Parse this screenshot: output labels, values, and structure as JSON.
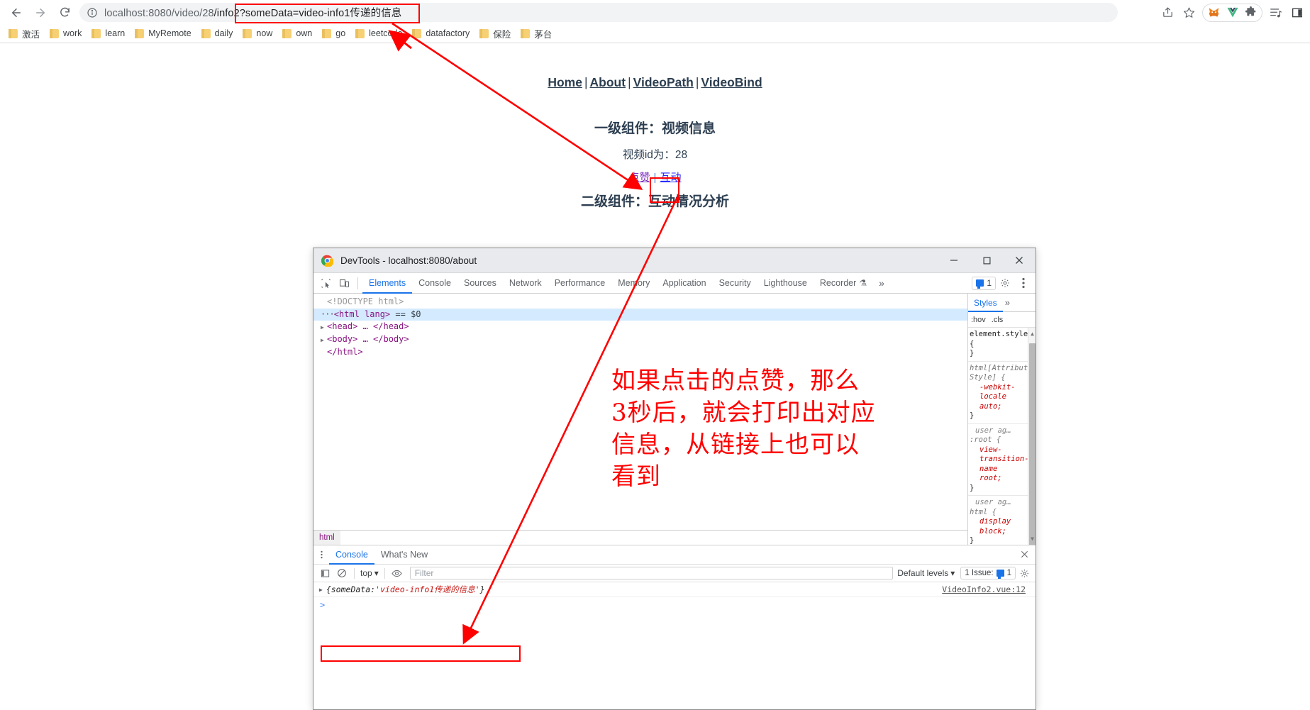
{
  "browser": {
    "nav": {
      "back": "back-arrow",
      "forward": "forward-arrow",
      "reload": "reload"
    },
    "omnibox": {
      "site_info_icon": "info-circle-icon",
      "url_prefix": "localhost:8080/video/28",
      "url_highlight": "/info2?someData=video-info1传递的信息",
      "full_url": "localhost:8080/video/28/info2?someData=video-info1传递的信息"
    },
    "toolbar_right": [
      "share-icon",
      "bookmark-star-icon",
      "metamask-extension-icon",
      "vue-devtools-extension-icon",
      "extensions-puzzle-icon",
      "reading-list-icon",
      "sidepanel-icon"
    ],
    "bookmarks": [
      {
        "label": "激活"
      },
      {
        "label": "work"
      },
      {
        "label": "learn"
      },
      {
        "label": "MyRemote"
      },
      {
        "label": "daily"
      },
      {
        "label": "now"
      },
      {
        "label": "own"
      },
      {
        "label": "go"
      },
      {
        "label": "leetcode"
      },
      {
        "label": "datafactory"
      },
      {
        "label": "保险"
      },
      {
        "label": "茅台"
      }
    ]
  },
  "page": {
    "nav_links": [
      "Home",
      "About",
      "VideoPath",
      "VideoBind"
    ],
    "nav_separator": "|",
    "heading_level1": "一级组件：视频信息",
    "video_id_text": "视频id为：28",
    "action_links": {
      "like": "点赞",
      "interact": "互动",
      "separator": "|"
    },
    "heading_level2": "二级组件：互动情况分析"
  },
  "devtools": {
    "window_title": "DevTools - localhost:8080/about",
    "window_buttons": {
      "minimize": "minimize-icon",
      "maximize": "maximize-icon",
      "close": "close-icon"
    },
    "toolbar_icons": [
      "inspect-element-icon",
      "device-toolbar-icon"
    ],
    "tabs": [
      "Elements",
      "Console",
      "Sources",
      "Network",
      "Performance",
      "Memory",
      "Application",
      "Security",
      "Lighthouse",
      "Recorder"
    ],
    "active_tab": "Elements",
    "recorder_flask": "⚗",
    "more_tabs": "»",
    "issue_count": "1",
    "settings_icon": "gear-icon",
    "kebab_icon": "kebab-menu-icon",
    "dom": {
      "doctype": "<!DOCTYPE html>",
      "html_open": "<html lang>",
      "selected_marker": "== $0",
      "head_line": "<head> … </head>",
      "body_line": "<body> … </body>",
      "html_close": "</html>"
    },
    "breadcrumb": "html",
    "styles": {
      "panel_tab": "Styles",
      "more": "»",
      "filter_hov": ":hov",
      "filter_cls": ".cls",
      "rules": [
        {
          "source": "",
          "selector": "element.style {",
          "props": [],
          "close": "}"
        },
        {
          "source": "",
          "selector": "html[Attributes Style] {",
          "props": [
            {
              "name": "-webkit-locale",
              "value": "auto;"
            }
          ],
          "close": "}"
        },
        {
          "source": "user ag…",
          "selector": ":root {",
          "props": [
            {
              "name": "view-transition-name",
              "value": "root;"
            }
          ],
          "close": "}"
        },
        {
          "source": "user ag…",
          "selector": "html {",
          "props": [
            {
              "name": "display",
              "value": "block;"
            }
          ],
          "close": "}"
        }
      ]
    },
    "drawer": {
      "tabs": [
        "Console",
        "What's New"
      ],
      "active_tab": "Console",
      "close_icon": "close-icon",
      "toolbar": {
        "sidebar_icon": "show-console-sidebar-icon",
        "clear_icon": "clear-console-icon",
        "context": "top",
        "eye_icon": "live-expression-icon",
        "filter_placeholder": "Filter",
        "filter_value": "",
        "levels": "Default levels",
        "issues_label": "1 Issue:",
        "issues_count": "1",
        "settings_icon": "gear-icon"
      },
      "logs": [
        {
          "expand": "▶",
          "prefix": "{someData: ",
          "string": "'video-info1传递的信息'",
          "suffix": "}",
          "source": "VideoInfo2.vue:12"
        }
      ],
      "prompt": ">"
    }
  },
  "annotations": {
    "note_text": "如果点击的点赞，那么\n3秒后，就会打印出对应\n信息，从链接上也可以\n看到",
    "color": "#ff0000",
    "boxes": [
      "url-highlight-box",
      "like-link-box",
      "console-log-box"
    ],
    "arrows": [
      "url-to-like-arrow",
      "like-to-console-arrow",
      "bookmark-go-arrow",
      "filter-arrow"
    ]
  }
}
